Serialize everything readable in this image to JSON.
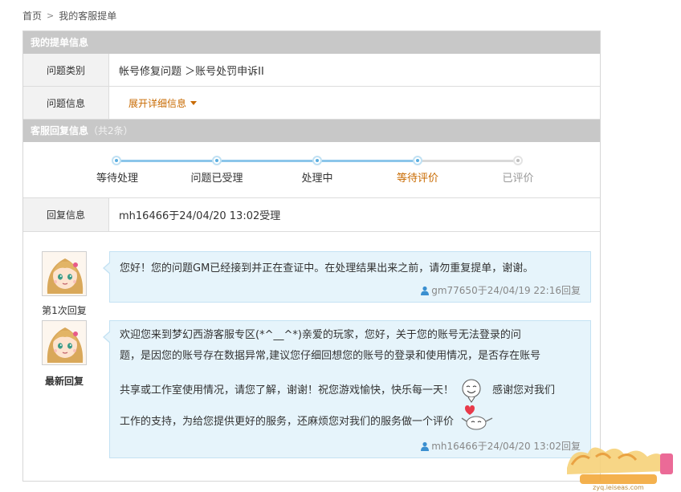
{
  "breadcrumb": {
    "home": "首页",
    "current": "我的客服提单"
  },
  "ticket": {
    "section_title": "我的提单信息",
    "category_label": "问题类别",
    "category_value": "帐号修复问题 ＞账号处罚申诉II",
    "info_label": "问题信息",
    "expand_link": "展开详细信息"
  },
  "reply_section": {
    "title": "客服回复信息",
    "count": "（共2条）"
  },
  "progress": {
    "steps": [
      "等待处理",
      "问题已受理",
      "处理中",
      "等待评价",
      "已评价"
    ],
    "current_step_index": 3
  },
  "reply_info": {
    "label": "回复信息",
    "value": "mh16466于24/04/20 13:02受理"
  },
  "replies": [
    {
      "caption": "第1次回复",
      "text": "您好！您的问题GM已经接到并正在查证中。在处理结果出来之前，请勿重复提单，谢谢。",
      "meta": "gm77650于24/04/19 22:16回复"
    },
    {
      "caption": "最新回复",
      "lines": [
        "欢迎您来到梦幻西游客服专区(*^__^*)亲爱的玩家，您好，关于您的账号无法登录的问",
        "题，是因您的账号存在数据异常,建议您仔细回想您的账号的登录和使用情况，是否存在账号",
        "共享或工作室使用情况，请您了解，谢谢！祝您游戏愉快，快乐每一天！",
        "感谢您对我们",
        "工作的支持，为给您提供更好的服务，还麻烦您对我们的服务做一个评价"
      ],
      "meta": "mh16466于24/04/20 13:02回复"
    }
  ],
  "watermark": {
    "url": "zyq.ieiseas.com"
  },
  "colors": {
    "accent": "#c86a00",
    "track": "#8cc6ea",
    "bubble": "#e6f4fb",
    "header": "#c8c8c8"
  }
}
